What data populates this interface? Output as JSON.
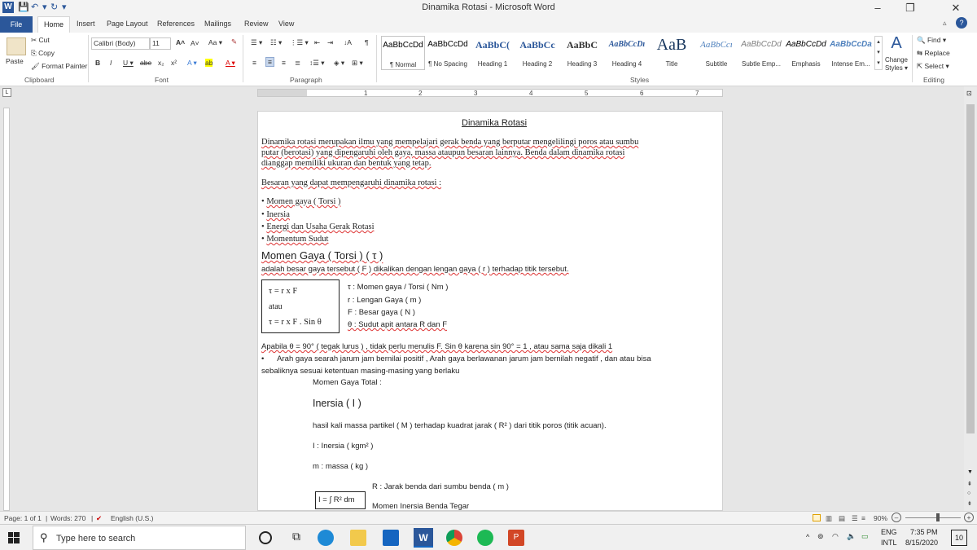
{
  "window": {
    "title": "Dinamika Rotasi  -  Microsoft Word"
  },
  "tabs": [
    "File",
    "Home",
    "Insert",
    "Page Layout",
    "References",
    "Mailings",
    "Review",
    "View"
  ],
  "ribbon": {
    "clipboard": {
      "paste": "Paste",
      "cut": "Cut",
      "copy": "Copy",
      "format_painter": "Format Painter",
      "label": "Clipboard"
    },
    "font": {
      "name": "Calibri (Body)",
      "size": "11",
      "label": "Font"
    },
    "paragraph": {
      "label": "Paragraph"
    },
    "styles": {
      "label": "Styles",
      "items": [
        {
          "preview": "AaBbCcDd",
          "name": "¶ Normal"
        },
        {
          "preview": "AaBbCcDd",
          "name": "¶ No Spacing"
        },
        {
          "preview": "AaBbC(",
          "name": "Heading 1"
        },
        {
          "preview": "AaBbCc",
          "name": "Heading 2"
        },
        {
          "preview": "AaBbC",
          "name": "Heading 3"
        },
        {
          "preview": "AaBbCcDı",
          "name": "Heading 4"
        },
        {
          "preview": "AaB",
          "name": "Title"
        },
        {
          "preview": "AaBbCcı",
          "name": "Subtitle"
        },
        {
          "preview": "AaBbCcDd",
          "name": "Subtle Emp..."
        },
        {
          "preview": "AaBbCcDd",
          "name": "Emphasis"
        },
        {
          "preview": "AaBbCcDa",
          "name": "Intense Em..."
        }
      ],
      "change_styles": "Change Styles"
    },
    "editing": {
      "find": "Find",
      "replace": "Replace",
      "select": "Select",
      "label": "Editing"
    }
  },
  "ruler_numbers": [
    "1",
    "2",
    "3",
    "4",
    "5",
    "6",
    "7"
  ],
  "document": {
    "title": "Dinamika Rotasi",
    "intro_lines": [
      "Dinamika rotasi merupakan ilmu yang mempelajari gerak benda yang berputar mengelilingi poros atau sumbu",
      "putar (berotasi) yang dipengaruhi oleh gaya, massa ataupun besaran lainnya. Benda dalam dinamika rotasi",
      "dianggap memiliki ukuran dan bentuk yang tetap."
    ],
    "besaran_heading": "Besaran yang dapat mempengaruhi dinamika rotasi :",
    "bullets": [
      "Momen gaya ( Torsi )",
      "Inersia",
      "Energi dan Usaha Gerak Rotasi",
      "Momentum Sudut"
    ],
    "momen_heading": "Momen Gaya ( Torsi ) ( τ )",
    "momen_def": "adalah besar gaya tersebut ( F ) dikalikan dengan lengan gaya ( r ) terhadap titik tersebut.",
    "formula_box": [
      "τ = r x F",
      "atau",
      "τ = r x F . Sin θ"
    ],
    "legend": [
      "τ : Momen gaya / Torsi ( Nm )",
      "r : Lengan Gaya ( m )",
      "F : Besar gaya ( N )",
      "θ : Sudut apit antara R dan F"
    ],
    "apabila": "Apabila θ = 90° ( tegak lurus ) , tidak perlu menulis F. Sin θ karena sin 90° = 1 , atau sama saja dikali 1",
    "arah_lines": [
      "Arah gaya searah jarum jam bernilai positif , Arah gaya berlawanan jarum jam bernilah negatif , dan atau bisa",
      "sebaliknya sesuai ketentuan masing-masing yang berlaku"
    ],
    "momen_total": "Momen Gaya Total :",
    "inersia_heading": "Inersia ( I )",
    "inersia_def": "hasil kali massa partikel ( M ) terhadap kuadrat jarak ( R² ) dari titik poros (titik acuan).",
    "inersia_I": "I : Inersia ( kgm² )",
    "inersia_m": "m : massa ( kg )",
    "inersia_R": "R : Jarak benda dari sumbu benda ( m )",
    "integral_box": "I = ∫ R² dm",
    "momen_inersia_tegar": "Momen Inersia Benda Tegar"
  },
  "statusbar": {
    "page": "Page: 1 of 1",
    "words": "Words: 270",
    "language": "English (U.S.)",
    "zoom": "90%"
  },
  "taskbar": {
    "search_placeholder": "Type here to search",
    "lang_top": "ENG",
    "lang_bottom": "INTL",
    "time": "7:35 PM",
    "date": "8/15/2020",
    "notifications": "10"
  },
  "colors": {
    "word_blue": "#2b579a",
    "spell_red": "#d33333"
  }
}
